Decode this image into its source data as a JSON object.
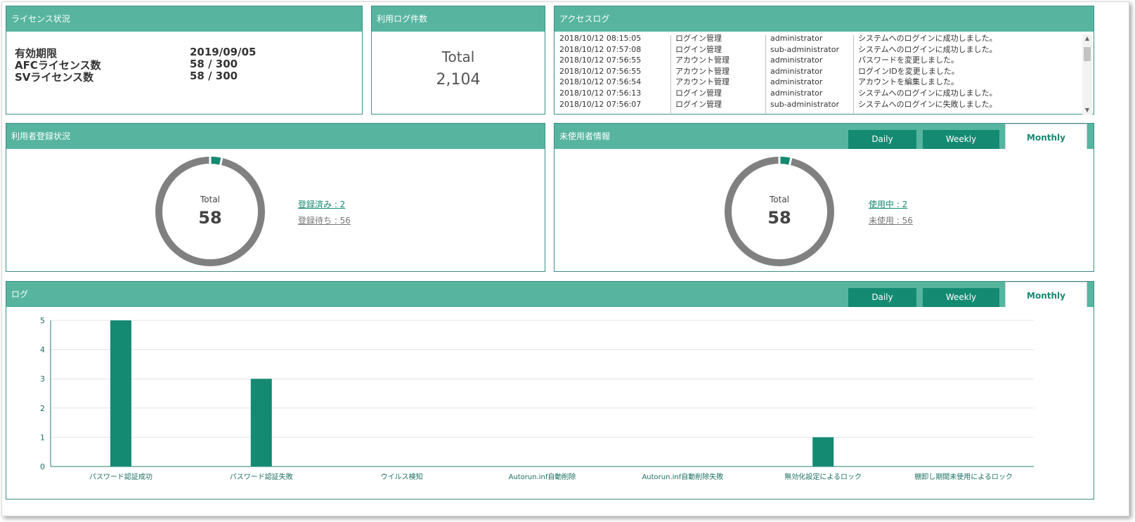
{
  "license": {
    "title": "ライセンス状況",
    "rows": [
      {
        "label": "有効期限",
        "value": "2019/09/05"
      },
      {
        "label": "AFCライセンス数",
        "value": "58 / 300"
      },
      {
        "label": "SVライセンス数",
        "value": "58 / 300"
      }
    ]
  },
  "usage_log_count": {
    "title": "利用ログ件数",
    "total_label": "Total",
    "total_value": "2,104"
  },
  "access_log": {
    "title": "アクセスログ",
    "rows": [
      {
        "time": "2018/10/12 08:15:05",
        "category": "ログイン管理",
        "user": "administrator",
        "message": "システムへのログインに成功しました。"
      },
      {
        "time": "2018/10/12 07:57:08",
        "category": "ログイン管理",
        "user": "sub-administrator",
        "message": "システムへのログインに成功しました。"
      },
      {
        "time": "2018/10/12 07:56:55",
        "category": "アカウント管理",
        "user": "administrator",
        "message": "パスワードを変更しました。"
      },
      {
        "time": "2018/10/12 07:56:55",
        "category": "アカウント管理",
        "user": "administrator",
        "message": "ログインIDを変更しました。"
      },
      {
        "time": "2018/10/12 07:56:54",
        "category": "アカウント管理",
        "user": "administrator",
        "message": "アカウントを編集しました。"
      },
      {
        "time": "2018/10/12 07:56:13",
        "category": "ログイン管理",
        "user": "administrator",
        "message": "システムへのログインに成功しました。"
      },
      {
        "time": "2018/10/12 07:56:07",
        "category": "ログイン管理",
        "user": "sub-administrator",
        "message": "システムへのログインに失敗しました。"
      }
    ]
  },
  "user_registration": {
    "title": "利用者登録状況",
    "total_label": "Total",
    "total_value": "58",
    "registered_label": "登録済み : 2",
    "pending_label": "登録待ち : 56",
    "registered_fraction": 0.0345,
    "colors": {
      "registered": "#148a72",
      "pending": "#808080"
    }
  },
  "unused_users": {
    "title": "未使用者情報",
    "tabs": [
      "Daily",
      "Weekly",
      "Monthly"
    ],
    "active_tab": "Monthly",
    "total_label": "Total",
    "total_value": "58",
    "in_use_label": "使用中 : 2",
    "unused_label": "未使用 : 56",
    "in_use_fraction": 0.0345,
    "colors": {
      "in_use": "#148a72",
      "unused": "#808080"
    }
  },
  "log_panel": {
    "title": "ログ",
    "tabs": [
      "Daily",
      "Weekly",
      "Monthly"
    ],
    "active_tab": "Monthly"
  },
  "theme": {
    "header_bg": "#57b59f",
    "accent": "#148a72",
    "axis_text": "#1b6f63"
  },
  "chart_data": {
    "type": "bar",
    "categories": [
      "パスワード認証成功",
      "パスワード認証失敗",
      "ウイルス検知",
      "Autorun.inf自動削除",
      "Autorun.inf自動削除失敗",
      "無効化設定によるロック",
      "棚卸し期間未使用によるロック"
    ],
    "values": [
      5,
      3,
      0,
      0,
      0,
      1,
      0
    ],
    "ylim": [
      0,
      5
    ],
    "yticks": [
      0,
      1,
      2,
      3,
      4,
      5
    ],
    "grid": true
  }
}
